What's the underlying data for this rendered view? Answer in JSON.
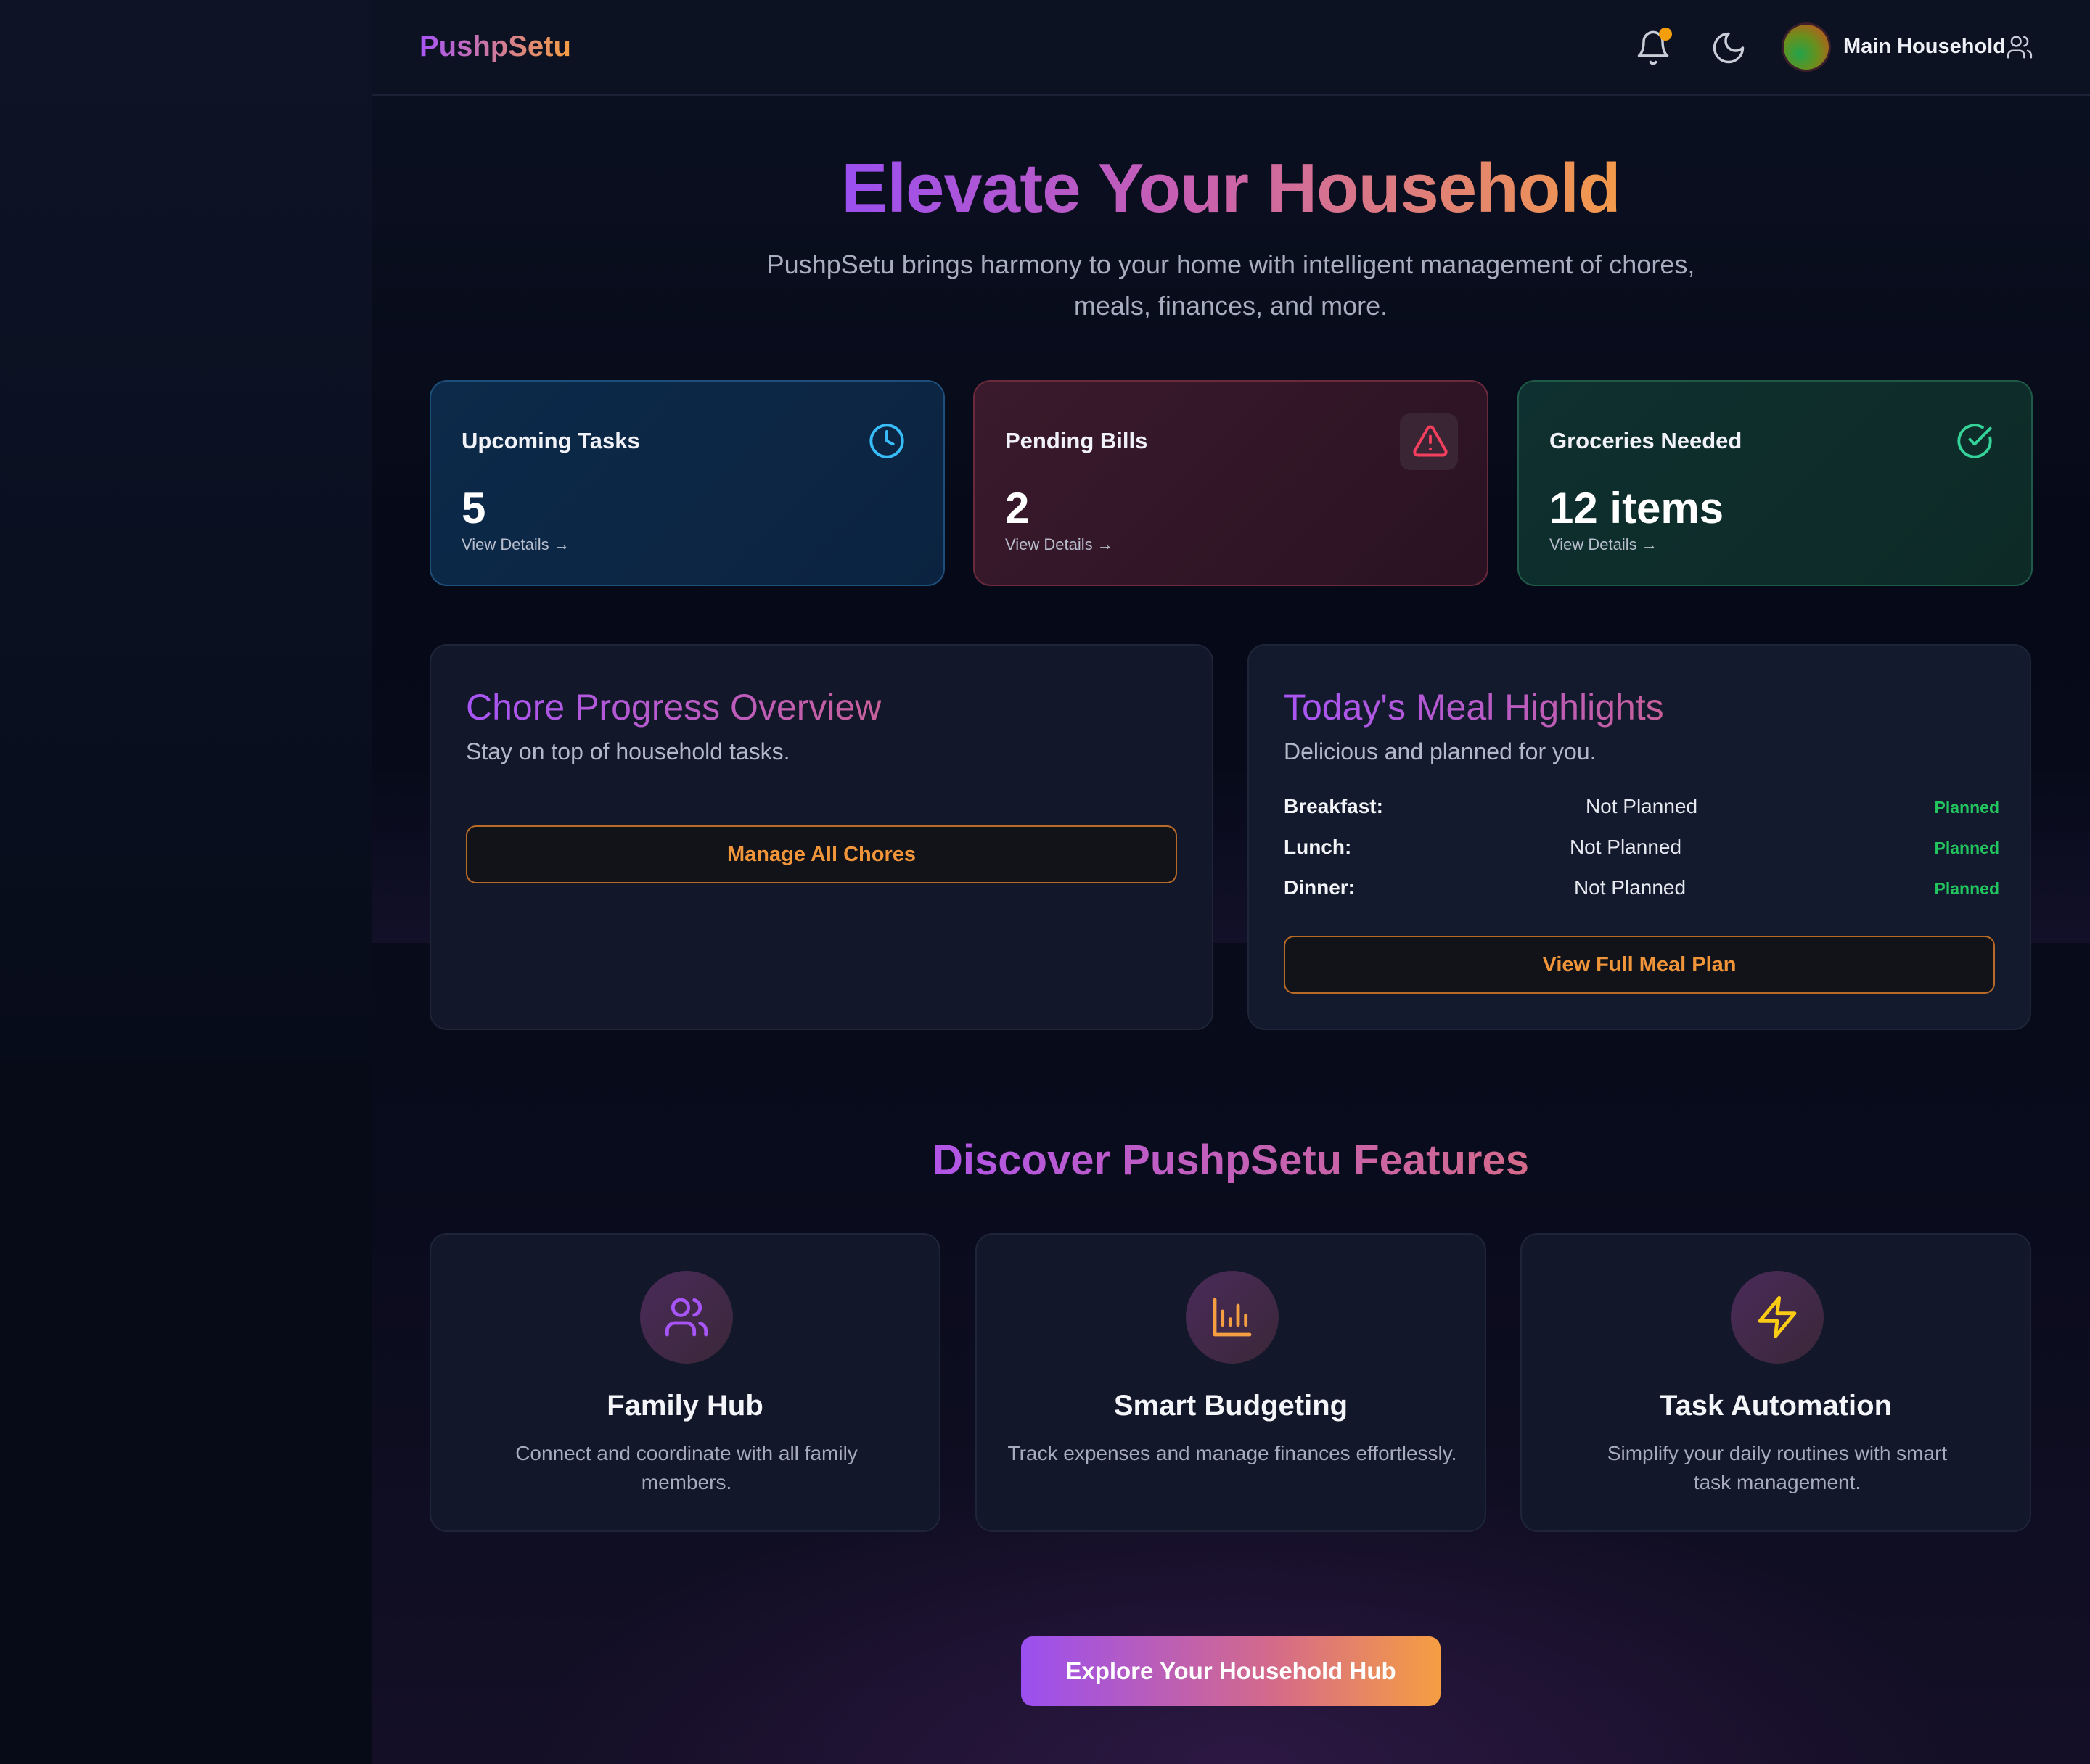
{
  "app": {
    "name": "PushpSetu"
  },
  "header": {
    "household_name": "Main Household",
    "icons": [
      "bell-icon",
      "moon-icon",
      "users-icon"
    ],
    "notification_dot_color": "#f59e0b"
  },
  "hero": {
    "title": "Elevate Your Household",
    "subtitle": "PushpSetu brings harmony to your home with intelligent management of chores, meals, finances, and more."
  },
  "stats": [
    {
      "title": "Upcoming Tasks",
      "value": "5",
      "link": "View Details →",
      "icon": "clock-icon",
      "accent": "#38bdf8"
    },
    {
      "title": "Pending Bills",
      "value": "2",
      "link": "View Details →",
      "icon": "alert-triangle-icon",
      "accent": "#f43f5e"
    },
    {
      "title": "Groceries Needed",
      "value": "12 items",
      "link": "View Details →",
      "icon": "check-circle-icon",
      "accent": "#34d399"
    }
  ],
  "chores": {
    "title": "Chore Progress Overview",
    "subtitle": "Stay on top of household tasks.",
    "button": "Manage All Chores"
  },
  "meals": {
    "title": "Today's Meal Highlights",
    "subtitle": "Delicious and planned for you.",
    "rows": [
      {
        "label": "Breakfast:",
        "value": "Not Planned",
        "status": "Planned"
      },
      {
        "label": "Lunch:",
        "value": "Not Planned",
        "status": "Planned"
      },
      {
        "label": "Dinner:",
        "value": "Not Planned",
        "status": "Planned"
      }
    ],
    "button": "View Full Meal Plan"
  },
  "features": {
    "title": "Discover PushpSetu Features",
    "items": [
      {
        "name": "Family Hub",
        "description": "Connect and coordinate with all family members.",
        "icon": "users-icon"
      },
      {
        "name": "Smart Budgeting",
        "description": "Track expenses and manage finances effortlessly.",
        "icon": "bar-chart-icon"
      },
      {
        "name": "Task Automation",
        "description": "Simplify your daily routines with smart task management.",
        "icon": "lightning-icon"
      }
    ]
  },
  "cta": {
    "label": "Explore Your Household Hub"
  },
  "colors": {
    "brand_purple": "#a855f7",
    "brand_orange": "#f59e42",
    "status_green": "#22c55e"
  }
}
